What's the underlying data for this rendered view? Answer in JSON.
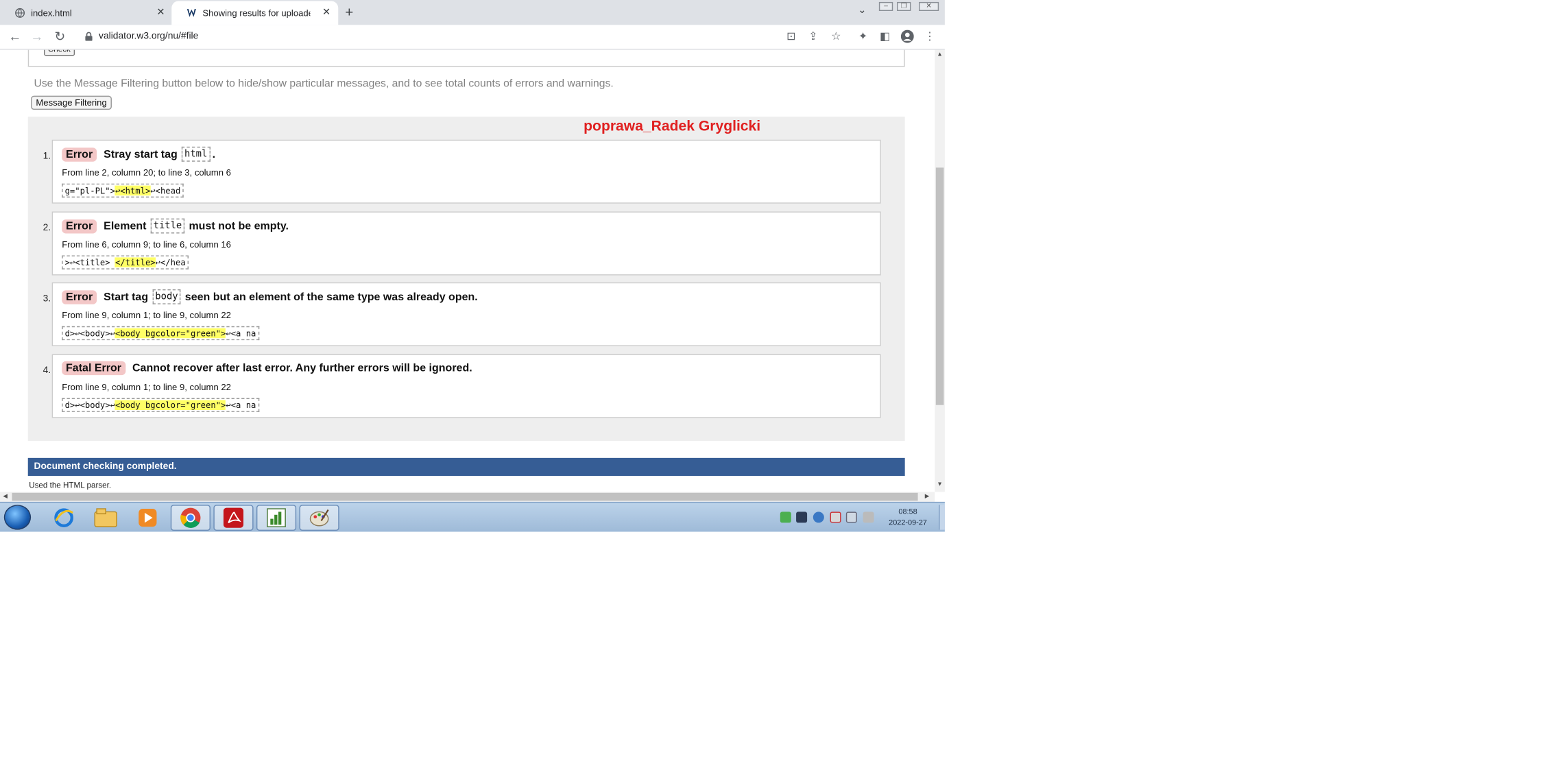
{
  "browser": {
    "tabs": [
      {
        "title": "index.html",
        "close": "✕"
      },
      {
        "title": "Showing results for uploaded file",
        "close": "✕"
      }
    ],
    "new_tab": "+",
    "url": "validator.w3.org/nu/#file"
  },
  "page": {
    "check_button": "Check",
    "filter_hint": "Use the Message Filtering button below to hide/show particular messages, and to see total counts of errors and warnings.",
    "filter_button": "Message Filtering",
    "signature": "poprawa_Radek Gryglicki",
    "messages": [
      {
        "number": "1.",
        "type": "Error",
        "text_before": "Stray start tag",
        "code": "html",
        "text_after": ".",
        "location": "From line 2, column 20; to line 3, column 6",
        "extract_pre": "g=\"pl-PL\">",
        "extract_hl": "↩<html>",
        "extract_post": "↩<head"
      },
      {
        "number": "2.",
        "type": "Error",
        "text_before": "Element",
        "code": "title",
        "text_after": "must not be empty.",
        "location": "From line 6, column 9; to line 6, column 16",
        "extract_pre": ">↩<title> ",
        "extract_hl": "</title>",
        "extract_post": "↩</hea"
      },
      {
        "number": "3.",
        "type": "Error",
        "text_before": "Start tag",
        "code": "body",
        "text_after": "seen but an element of the same type was already open.",
        "location": "From line 9, column 1; to line 9, column 22",
        "extract_pre": "d>↩<body>↩",
        "extract_hl": "<body bgcolor=\"green\">",
        "extract_post": "↩<a na"
      },
      {
        "number": "4.",
        "type": "Fatal Error",
        "text_before": "Cannot recover after last error. Any further errors will be ignored.",
        "code": "",
        "text_after": "",
        "location": "From line 9, column 1; to line 9, column 22",
        "extract_pre": "d>↩<body>↩",
        "extract_hl": "<body bgcolor=\"green\">",
        "extract_post": "↩<a na"
      }
    ],
    "completed": "Document checking completed.",
    "parser_note": "Used the HTML parser."
  },
  "taskbar": {
    "clock_time": "08:58",
    "clock_date": "2022-09-27",
    "apps": [
      "internet-explorer-icon",
      "file-explorer-icon",
      "media-player-icon",
      "chrome-icon",
      "acrobat-icon",
      "chart-app-icon",
      "paint-app-icon"
    ]
  },
  "colors": {
    "error_badge": "#f3c7c7",
    "highlight": "#ffff66",
    "completed_bar": "#365d95",
    "signature": "#e02020"
  }
}
